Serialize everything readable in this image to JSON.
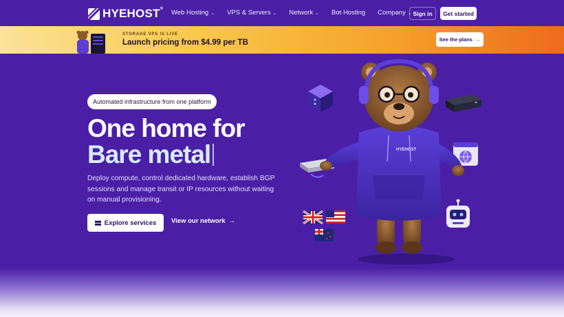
{
  "brand": {
    "name": "HYEHOST",
    "mark": "®"
  },
  "nav": {
    "items": [
      {
        "label": "Web Hosting",
        "has_menu": true
      },
      {
        "label": "VPS & Servers",
        "has_menu": true
      },
      {
        "label": "Network",
        "has_menu": true
      },
      {
        "label": "Bot Hosting",
        "has_menu": false
      },
      {
        "label": "Company",
        "has_menu": true
      }
    ],
    "signin": "Sign in",
    "get_started": "Get started"
  },
  "banner": {
    "eyebrow": "STORAGE VPS IS LIVE",
    "title": "Launch pricing from $4.99 per TB",
    "cta": "See the plans"
  },
  "hero": {
    "pill": "Automated infrastructure from one platform",
    "headline_1": "One home for",
    "headline_2": "Bare metal",
    "description": "Deploy compute, control dedicated hardware, establish BGP sessions and manage transit or IP resources without waiting on manual provisioning.",
    "primary_cta": "Explore services",
    "secondary_cta": "View our network"
  },
  "mascot": {
    "hoodie_text": "HYEHOST"
  },
  "colors": {
    "bg": "#4a1fa6",
    "accent_light": "#d9ecff",
    "banner_start": "#fbe39a",
    "banner_end": "#ee6a1c"
  }
}
